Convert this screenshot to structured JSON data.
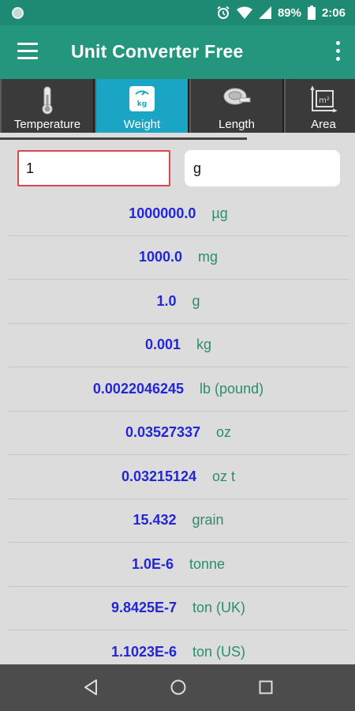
{
  "status_bar": {
    "battery": "89%",
    "time": "2:06"
  },
  "app_bar": {
    "title": "Unit Converter Free",
    "menu_icon": "hamburger-menu-icon",
    "overflow_icon": "more-vert-icon"
  },
  "tabs": [
    {
      "label": "Temperature",
      "icon": "thermometer-icon",
      "selected": false
    },
    {
      "label": "Weight",
      "icon": "scale-kg-icon",
      "selected": true
    },
    {
      "label": "Length",
      "icon": "tape-measure-icon",
      "selected": false
    },
    {
      "label": "Area",
      "icon": "area-m2-icon",
      "selected": false
    }
  ],
  "input": {
    "value": "1",
    "unit": "g"
  },
  "results": [
    {
      "value": "1000000.0",
      "unit": "µg"
    },
    {
      "value": "1000.0",
      "unit": "mg"
    },
    {
      "value": "1.0",
      "unit": "g"
    },
    {
      "value": "0.001",
      "unit": "kg"
    },
    {
      "value": "0.0022046245",
      "unit": "lb (pound)"
    },
    {
      "value": "0.03527337",
      "unit": "oz"
    },
    {
      "value": "0.03215124",
      "unit": "oz t"
    },
    {
      "value": "15.432",
      "unit": "grain"
    },
    {
      "value": "1.0E-6",
      "unit": "tonne"
    },
    {
      "value": "9.8425E-7",
      "unit": "ton (UK)"
    },
    {
      "value": "1.1023E-6",
      "unit": "ton (US)"
    }
  ],
  "colors": {
    "status_bar": "#1f8a74",
    "app_bar": "#23967d",
    "tab_selected": "#1aa5c4",
    "value_text": "#2226d6",
    "unit_text": "#2c8c6f",
    "input_border": "#d9484c"
  }
}
